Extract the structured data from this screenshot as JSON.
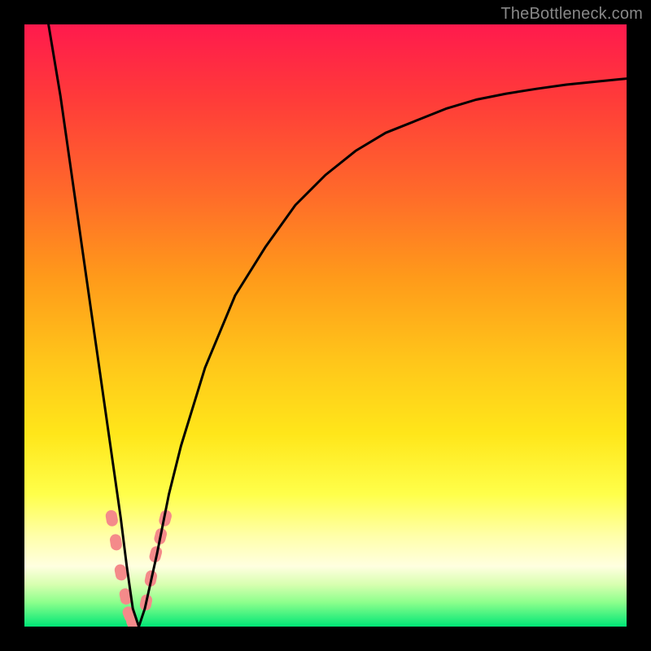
{
  "watermark": "TheBottleneck.com",
  "chart_data": {
    "type": "line",
    "title": "",
    "xlabel": "",
    "ylabel": "",
    "xlim": [
      0,
      100
    ],
    "ylim": [
      0,
      100
    ],
    "grid": false,
    "legend": false,
    "background_gradient": {
      "top_color": "#ff1a4d",
      "bottom_color": "#00e676",
      "meaning": "red high to green low"
    },
    "series": [
      {
        "name": "bottleneck-curve",
        "color": "#000000",
        "x": [
          4,
          6,
          8,
          10,
          12,
          14,
          16,
          17,
          18,
          19,
          20,
          22,
          24,
          26,
          30,
          35,
          40,
          45,
          50,
          55,
          60,
          65,
          70,
          75,
          80,
          85,
          90,
          95,
          100
        ],
        "y": [
          100,
          88,
          74,
          60,
          46,
          32,
          18,
          10,
          3,
          0,
          3,
          12,
          22,
          30,
          43,
          55,
          63,
          70,
          75,
          79,
          82,
          84,
          86,
          87.5,
          88.5,
          89.3,
          90,
          90.5,
          91
        ]
      },
      {
        "name": "highlight-dots-left",
        "color": "#f48a8a",
        "type": "scatter",
        "marker": "pill",
        "x": [
          14.5,
          15.2,
          16.0,
          16.8,
          17.4,
          18.0
        ],
        "y": [
          18,
          14,
          9,
          5,
          2,
          0.5
        ]
      },
      {
        "name": "highlight-dots-right",
        "color": "#f48a8a",
        "type": "scatter",
        "marker": "pill",
        "x": [
          20.2,
          21.0,
          21.8,
          22.6,
          23.4
        ],
        "y": [
          4,
          8,
          12,
          15,
          18
        ]
      }
    ]
  }
}
